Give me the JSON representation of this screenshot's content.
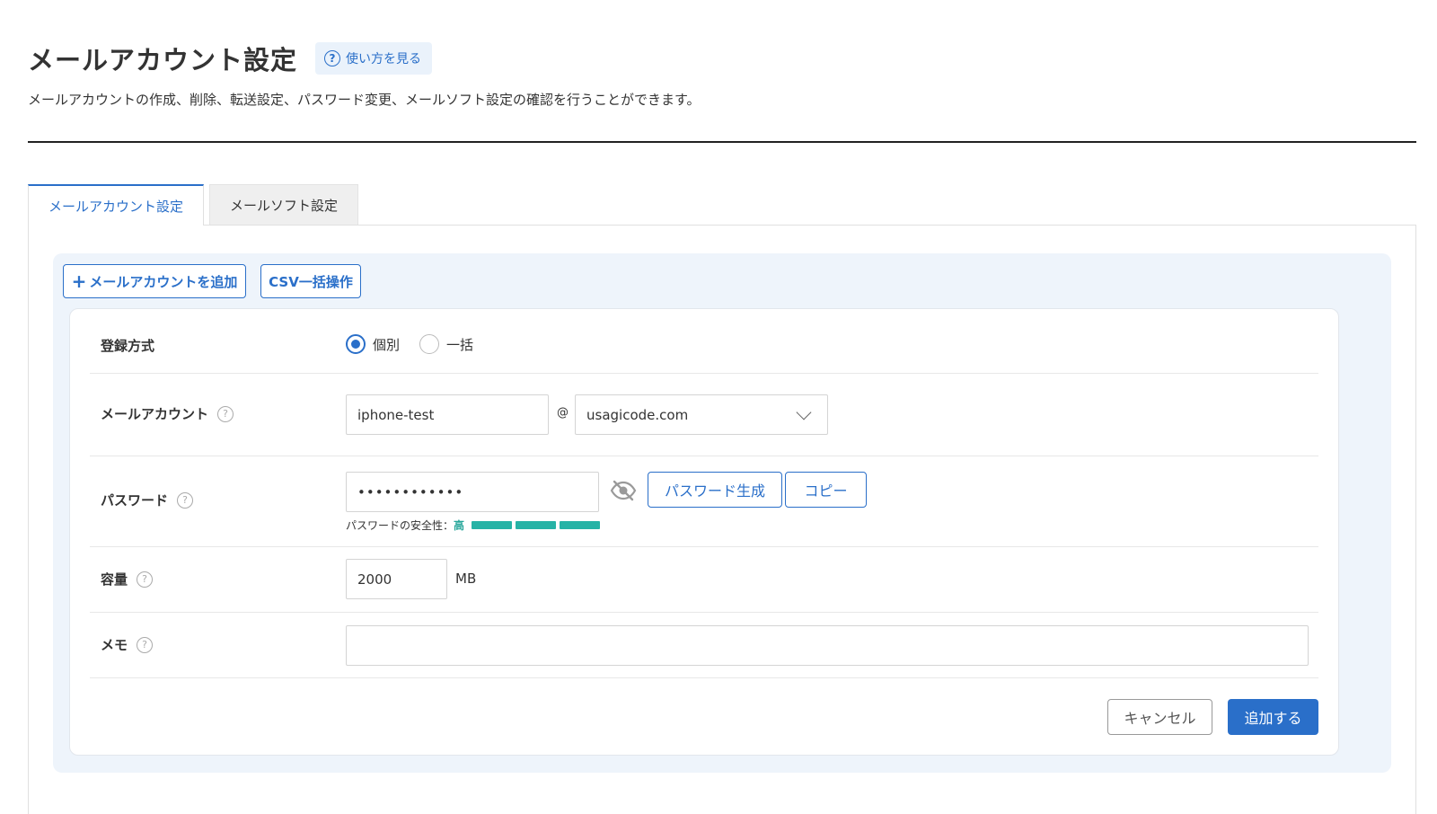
{
  "page": {
    "title": "メールアカウント設定",
    "help_link": "使い方を見る",
    "description": "メールアカウントの作成、削除、転送設定、パスワード変更、メールソフト設定の確認を行うことができます。"
  },
  "tabs": [
    {
      "label": "メールアカウント設定",
      "active": true
    },
    {
      "label": "メールソフト設定",
      "active": false
    }
  ],
  "toolbar": {
    "add_account_icon": "+",
    "add_account_label": "メールアカウントを追加",
    "csv_label": "CSV一括操作"
  },
  "form": {
    "registration": {
      "label": "登録方式",
      "options": [
        {
          "label": "個別",
          "checked": true
        },
        {
          "label": "一括",
          "checked": false
        }
      ]
    },
    "account": {
      "label": "メールアカウント",
      "local_part": "iphone-test",
      "at": "@",
      "domain": "usagicode.com"
    },
    "password": {
      "label": "パスワード",
      "value": "••••••••••••",
      "generate_label": "パスワード生成",
      "copy_label": "コピー",
      "strength_label": "パスワードの安全性：",
      "strength_level": "高",
      "strength_segments": 3,
      "strength_color": "#26b3a6"
    },
    "quota": {
      "label": "容量",
      "value": "2000",
      "unit": "MB"
    },
    "memo": {
      "label": "メモ",
      "value": ""
    },
    "cancel_label": "キャンセル",
    "submit_label": "追加する"
  },
  "colors": {
    "accent": "#2a6fc9",
    "panel_bg": "#eef4fb"
  }
}
